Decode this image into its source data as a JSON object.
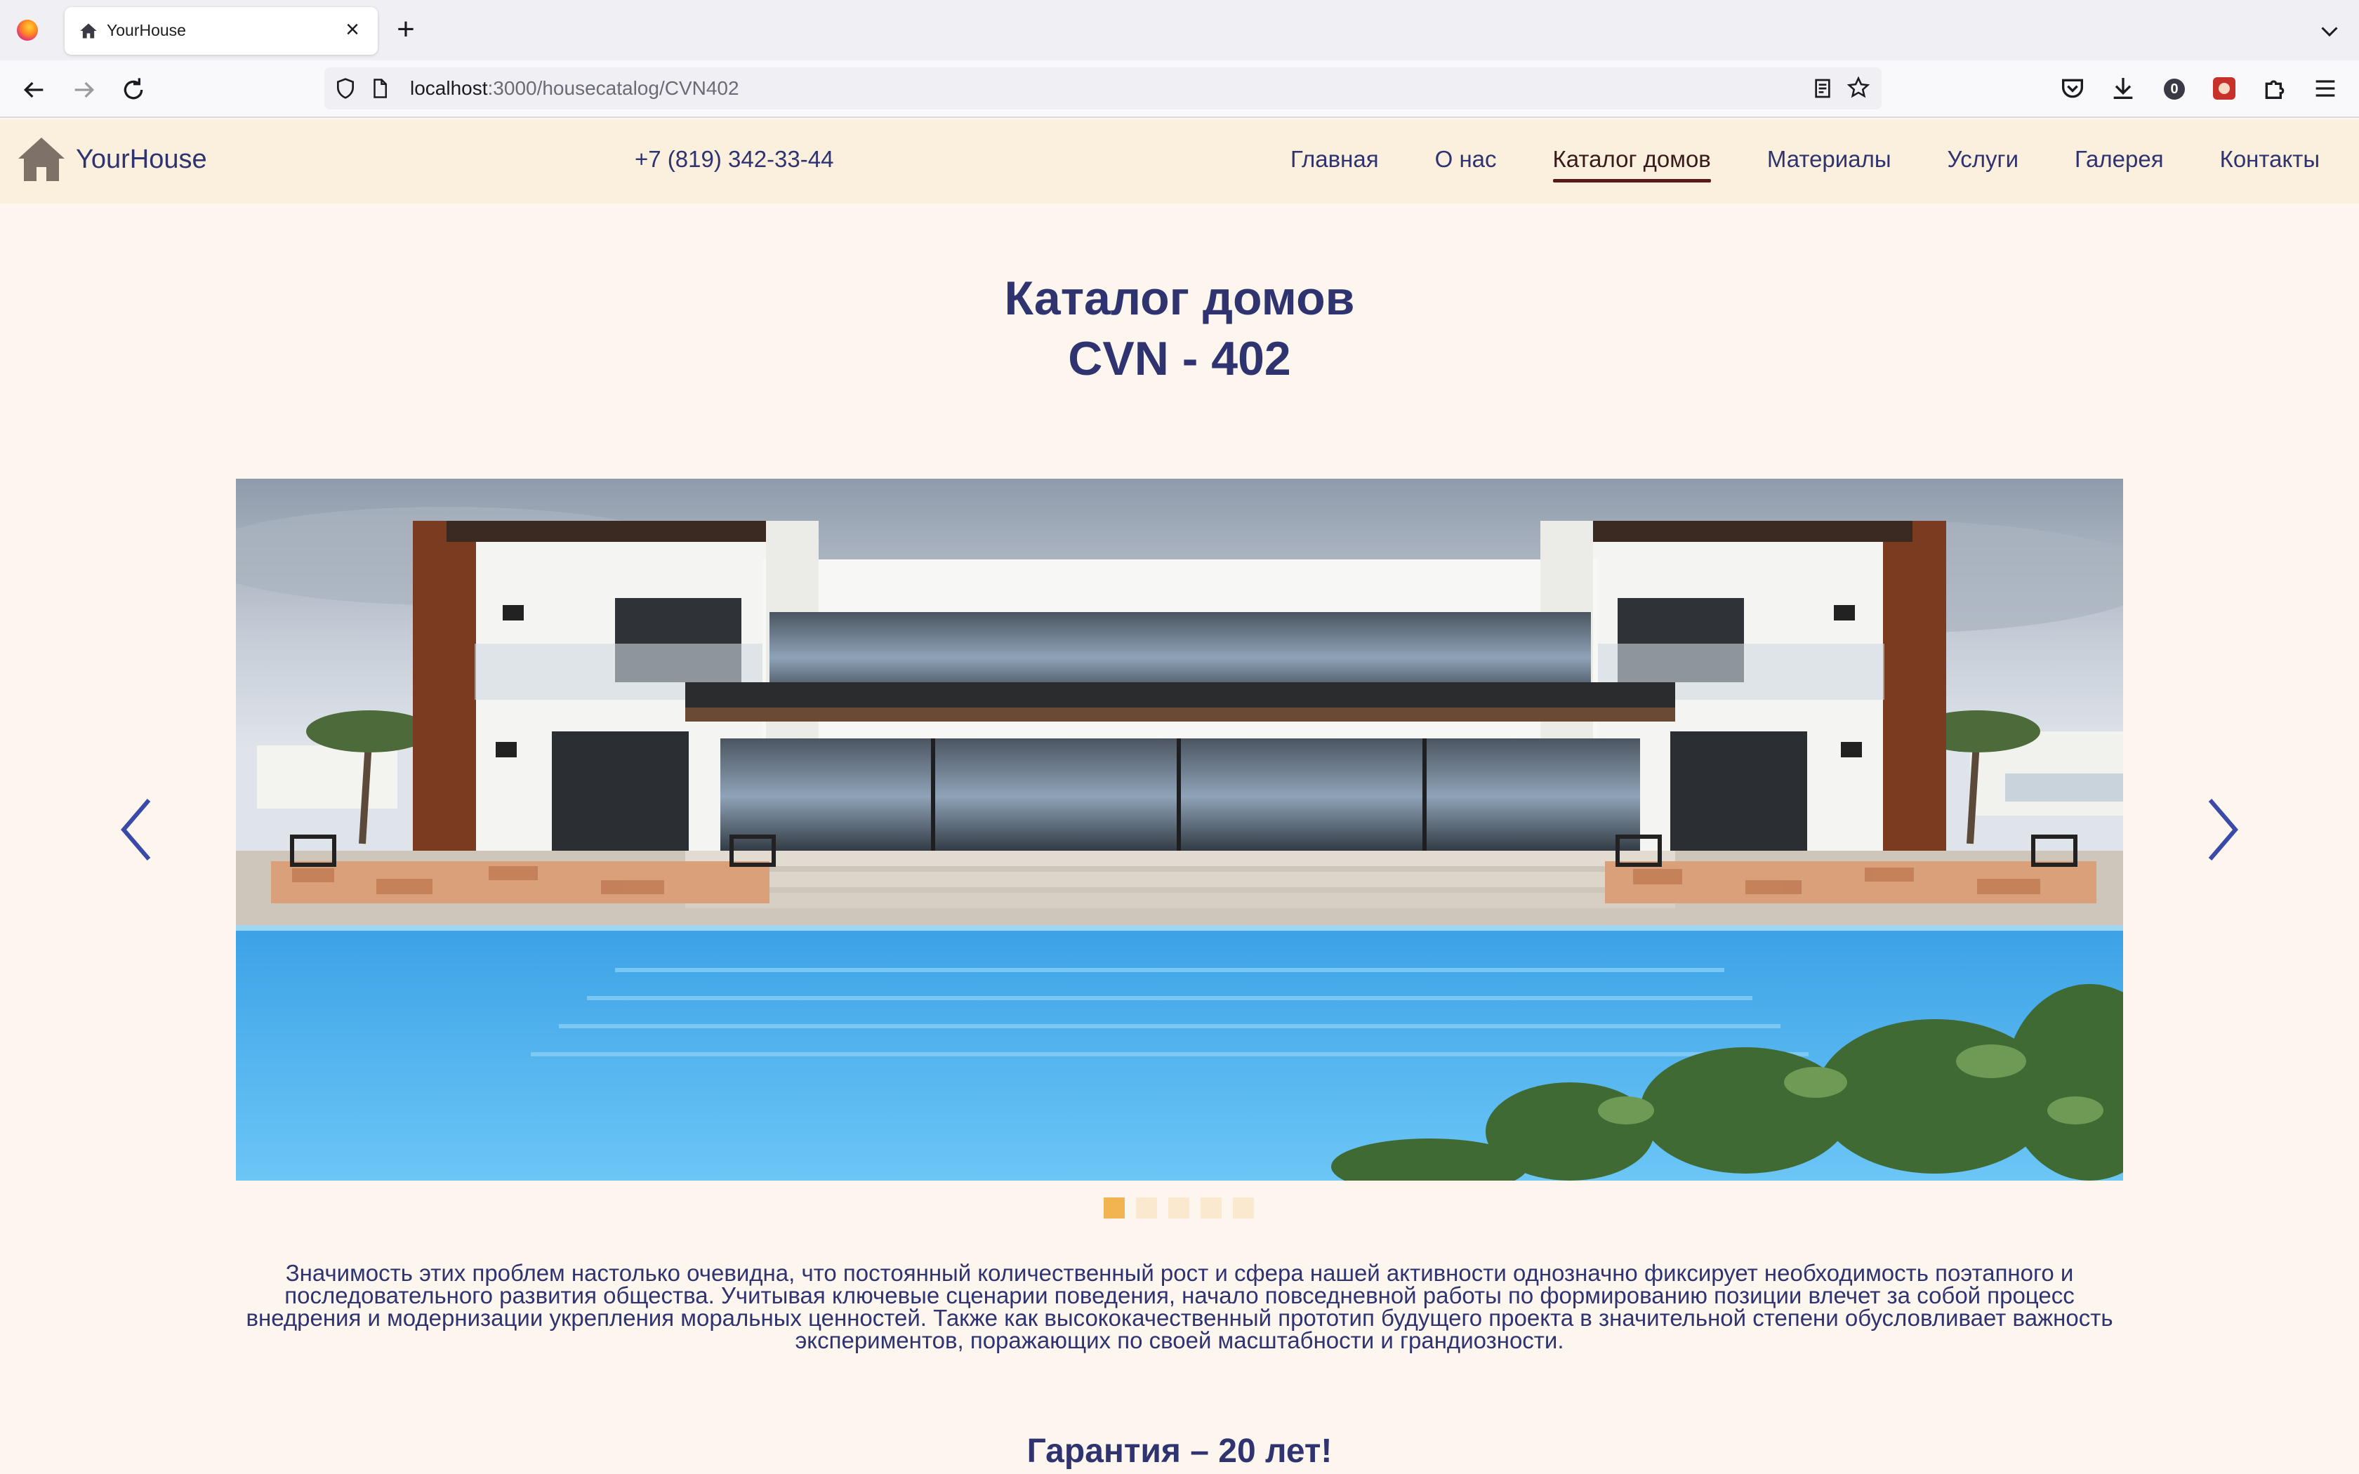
{
  "browser": {
    "tab_title": "YourHouse",
    "tab_close": "×",
    "new_tab": "+",
    "url_host": "localhost",
    "url_path": ":3000/housecatalog/CVN402",
    "extension_badge": "0"
  },
  "site": {
    "logo_text": "YourHouse",
    "phone": "+7 (819) 342-33-44",
    "menu": [
      {
        "label": "Главная",
        "active": false
      },
      {
        "label": "О нас",
        "active": false
      },
      {
        "label": "Каталог домов",
        "active": true
      },
      {
        "label": "Материалы",
        "active": false
      },
      {
        "label": "Услуги",
        "active": false
      },
      {
        "label": "Галерея",
        "active": false
      },
      {
        "label": "Контакты",
        "active": false
      }
    ]
  },
  "page": {
    "title_line1": "Каталог домов",
    "title_line2": "CVN - 402",
    "slider": {
      "total_slides": 5,
      "current_slide": 1
    },
    "description": "Значимость этих проблем настолько очевидна, что постоянный количественный рост и сфера нашей активности однозначно фиксирует необходимость поэтапного и последовательного развития общества. Учитывая ключевые сценарии поведения, начало повседневной работы по формированию позиции влечет за собой процесс внедрения и модернизации укрепления моральных ценностей. Также как высококачественный прототип будущего проекта в значительной степени обусловливает важность экспериментов, поражающих по своей масштабности и грандиозности.",
    "guarantee": "Гарантия – 20 лет!"
  },
  "colors": {
    "text_primary": "#2f3470",
    "header_bg": "#fbf0de",
    "page_bg": "#fdf6ee",
    "active_underline": "#5a1a1a",
    "dot_active": "#f2b451",
    "dot_inactive": "#fbe9cf",
    "arrow": "#3b4aa8"
  },
  "icons": {
    "logo": "house-icon",
    "prev": "chevron-left-icon",
    "next": "chevron-right-icon"
  }
}
